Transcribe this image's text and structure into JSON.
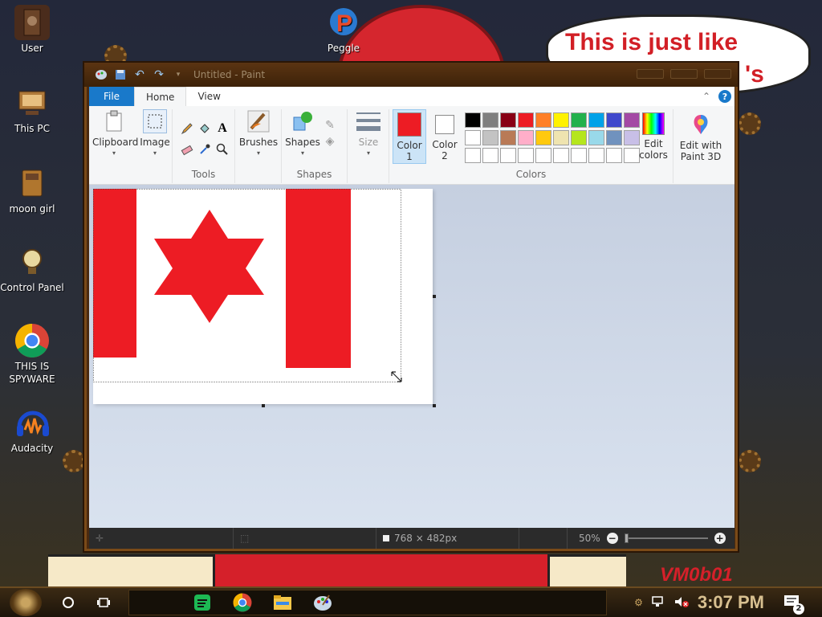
{
  "desktop": {
    "icons": [
      {
        "label": "User"
      },
      {
        "label": "This PC"
      },
      {
        "label": "moon girl"
      },
      {
        "label": "Control Panel"
      },
      {
        "label": "THIS IS SPYWARE"
      },
      {
        "label": "Audacity"
      },
      {
        "label": "Peggle"
      }
    ],
    "bubble_text": "This is just like",
    "bubble_text_tail": "'s",
    "watermark": "VM0b01"
  },
  "paint": {
    "title": "Untitled - Paint",
    "tabs": [
      {
        "label": "File"
      },
      {
        "label": "Home"
      },
      {
        "label": "View"
      }
    ],
    "help_label": "?",
    "clipboard": {
      "label": "Clipboard"
    },
    "image": {
      "label": "Image"
    },
    "tools_group": "Tools",
    "brushes": {
      "label": "Brushes"
    },
    "shapes": {
      "label": "Shapes",
      "group": "Shapes"
    },
    "size": {
      "label": "Size"
    },
    "color1": {
      "label_top": "Color",
      "label_bottom": "1",
      "value": "#ed1c24"
    },
    "color2": {
      "label_top": "Color",
      "label_bottom": "2",
      "value": "#ffffff"
    },
    "edit_colors": {
      "label_top": "Edit",
      "label_bottom": "colors"
    },
    "paint3d": {
      "label_top": "Edit with",
      "label_bottom": "Paint 3D"
    },
    "colors_group": "Colors",
    "palette_row1": [
      "#000000",
      "#7f7f7f",
      "#880015",
      "#ed1c24",
      "#ff7f27",
      "#fff200",
      "#22b14c",
      "#00a2e8",
      "#3f48cc",
      "#a349a4"
    ],
    "palette_row2": [
      "#ffffff",
      "#c3c3c3",
      "#b97a57",
      "#ffaec9",
      "#ffc90e",
      "#efe4b0",
      "#b5e61d",
      "#99d9ea",
      "#7092be",
      "#c8bfe7"
    ],
    "palette_row3": [
      "#ffffff",
      "#ffffff",
      "#ffffff",
      "#ffffff",
      "#ffffff",
      "#ffffff",
      "#ffffff",
      "#ffffff",
      "#ffffff",
      "#ffffff"
    ],
    "canvas": {
      "flag_color": "#ed1c24"
    },
    "status": {
      "dimensions": "768 × 482px",
      "zoom": "50%",
      "zoom_out": "−",
      "zoom_in": "+"
    }
  },
  "taskbar": {
    "time": "3:07 PM",
    "notification_count": "2"
  }
}
